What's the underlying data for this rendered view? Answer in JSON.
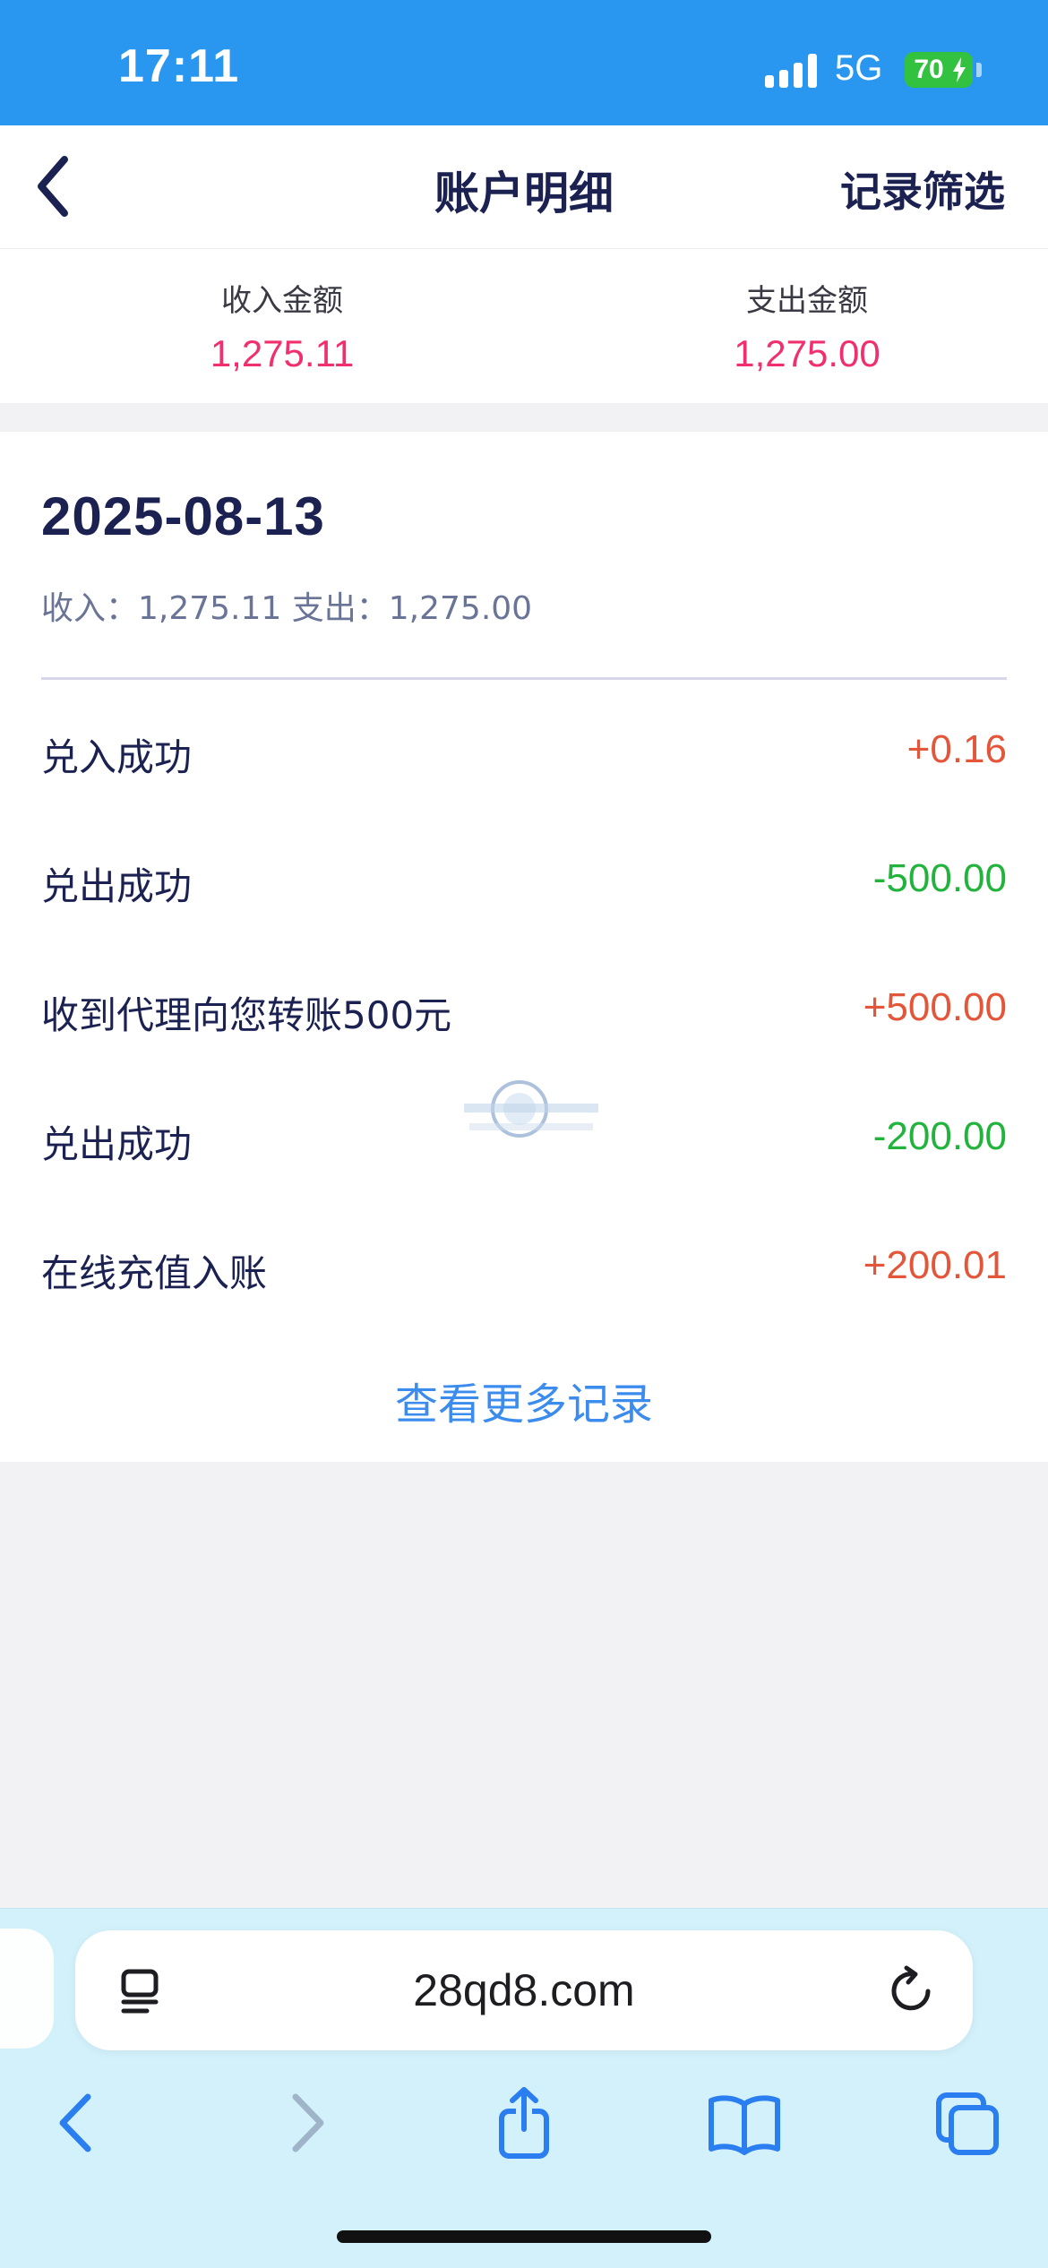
{
  "status_bar": {
    "time": "17:11",
    "network": "5G",
    "battery": "70"
  },
  "header": {
    "title": "账户明细",
    "filter_label": "记录筛选"
  },
  "summary": {
    "income_label": "收入金额",
    "income_value": "1,275.11",
    "expense_label": "支出金额",
    "expense_value": "1,275.00"
  },
  "records": {
    "date": "2025-08-13",
    "date_summary": "收入：1,275.11 支出：1,275.00",
    "items": [
      {
        "title": "兑入成功",
        "amount": "+0.16"
      },
      {
        "title": "兑出成功",
        "amount": "-500.00"
      },
      {
        "title": "收到代理向您转账500元",
        "amount": "+500.00"
      },
      {
        "title": "兑出成功",
        "amount": "-200.00"
      },
      {
        "title": "在线充值入账",
        "amount": "+200.01"
      }
    ],
    "more_label": "查看更多记录"
  },
  "browser": {
    "url": "28qd8.com"
  },
  "colors": {
    "status_bar": "#2997f0",
    "income_accent": "#f0306e",
    "amount_plus": "#e35639",
    "amount_minus": "#22b33c",
    "link": "#3c8cee",
    "browser_bar": "#d3f1fb"
  },
  "icons": [
    "back-chevron-icon",
    "signal-icon",
    "battery-icon",
    "reader-icon",
    "reload-icon",
    "back-arrow-icon",
    "forward-arrow-icon",
    "share-icon",
    "bookmarks-icon",
    "tabs-icon",
    "watermark-logo"
  ]
}
